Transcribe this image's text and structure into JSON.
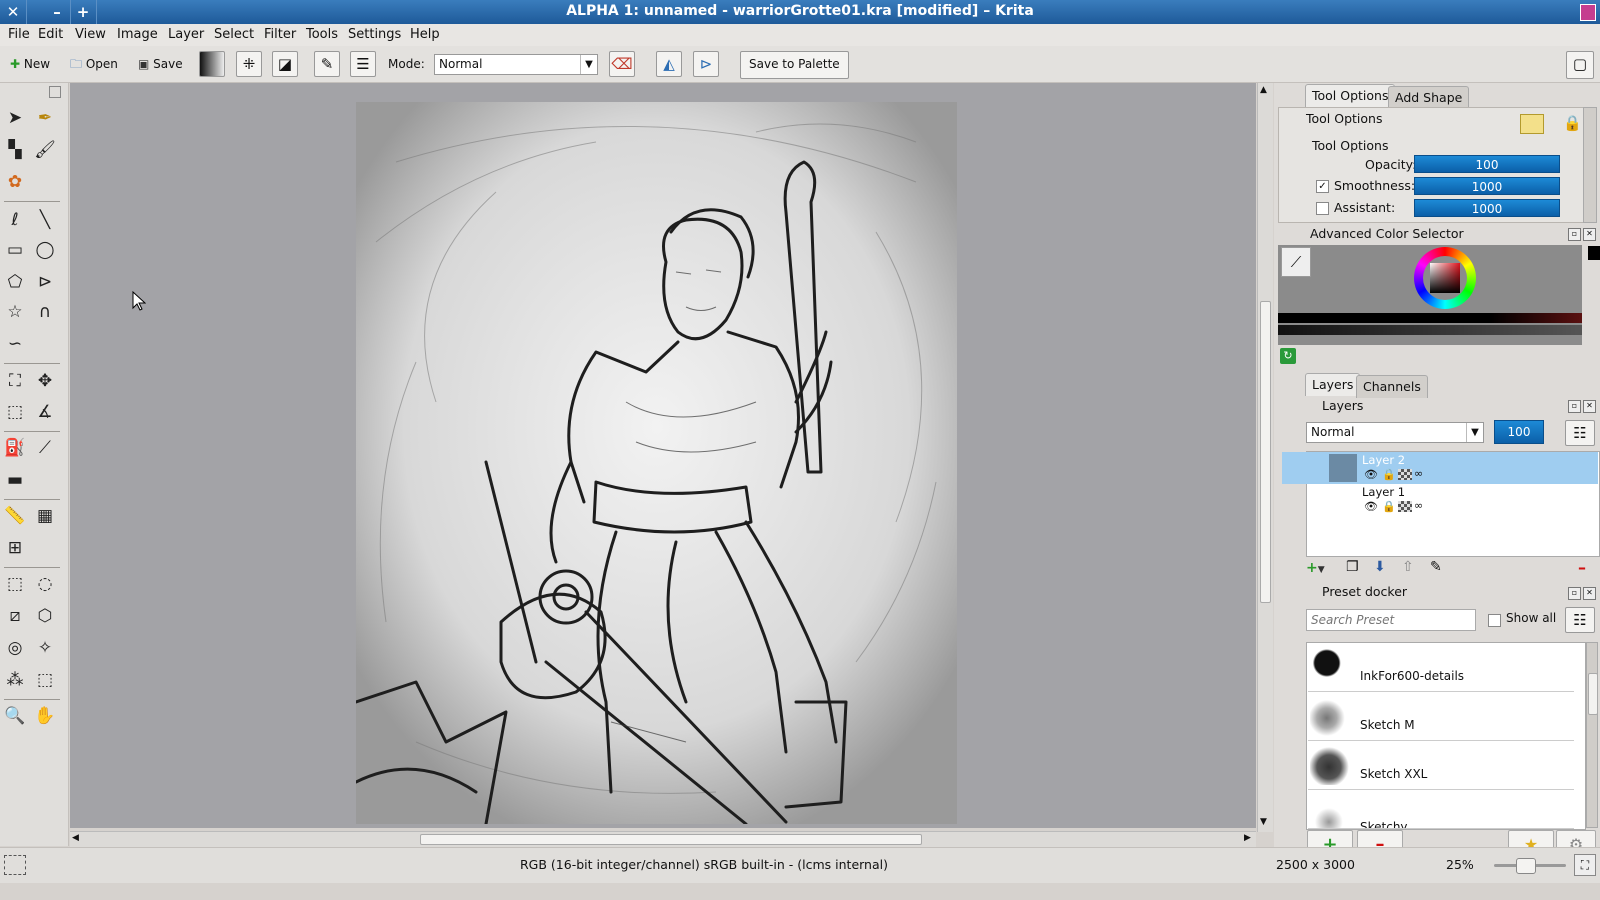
{
  "window": {
    "title": "ALPHA 1: unnamed - warriorGrotte01.kra [modified] – Krita",
    "close_glyph": "✕",
    "min_glyph": "–",
    "max_glyph": "+"
  },
  "menu": [
    "File",
    "Edit",
    "View",
    "Image",
    "Layer",
    "Select",
    "Filter",
    "Tools",
    "Settings",
    "Help"
  ],
  "toolbar": {
    "new_label": "New",
    "open_label": "Open",
    "save_label": "Save",
    "mode_label": "Mode:",
    "mode_value": "Normal",
    "save_palette_label": "Save to Palette"
  },
  "dock": {
    "tool_options_tab": "Tool Options",
    "add_shape_tab": "Add Shape",
    "tool_options_title": "Tool Options",
    "tool_options_group": "Tool Options",
    "opacity_label": "Opacity:",
    "opacity_value": "100",
    "smoothness_label": "Smoothness:",
    "smoothness_value": "1000",
    "smoothness_checked": true,
    "assistant_label": "Assistant:",
    "assistant_value": "1000",
    "assistant_checked": false,
    "color_selector_title": "Advanced Color Selector",
    "layers_tab": "Layers",
    "channels_tab": "Channels",
    "layers_title": "Layers",
    "layer_blend_mode": "Normal",
    "layer_opacity": "100",
    "layers": [
      {
        "name": "Layer 2",
        "selected": true
      },
      {
        "name": "Layer 1",
        "selected": false
      }
    ],
    "preset_title": "Preset docker",
    "preset_search_placeholder": "Search Preset",
    "show_all_label": "Show all",
    "presets": [
      "InkFor600-details",
      "Sketch M",
      "Sketch XXL",
      "Sketchy"
    ]
  },
  "status": {
    "color_info": "RGB (16-bit integer/channel)  sRGB built-in - (lcms internal)",
    "dimensions": "2500 x 3000",
    "zoom": "25%"
  },
  "colors": {
    "accent": "#1479c4",
    "titlebar": "#2a6aab",
    "canvas_bg": "#a3a3a7",
    "selection": "#9fcdf0"
  }
}
